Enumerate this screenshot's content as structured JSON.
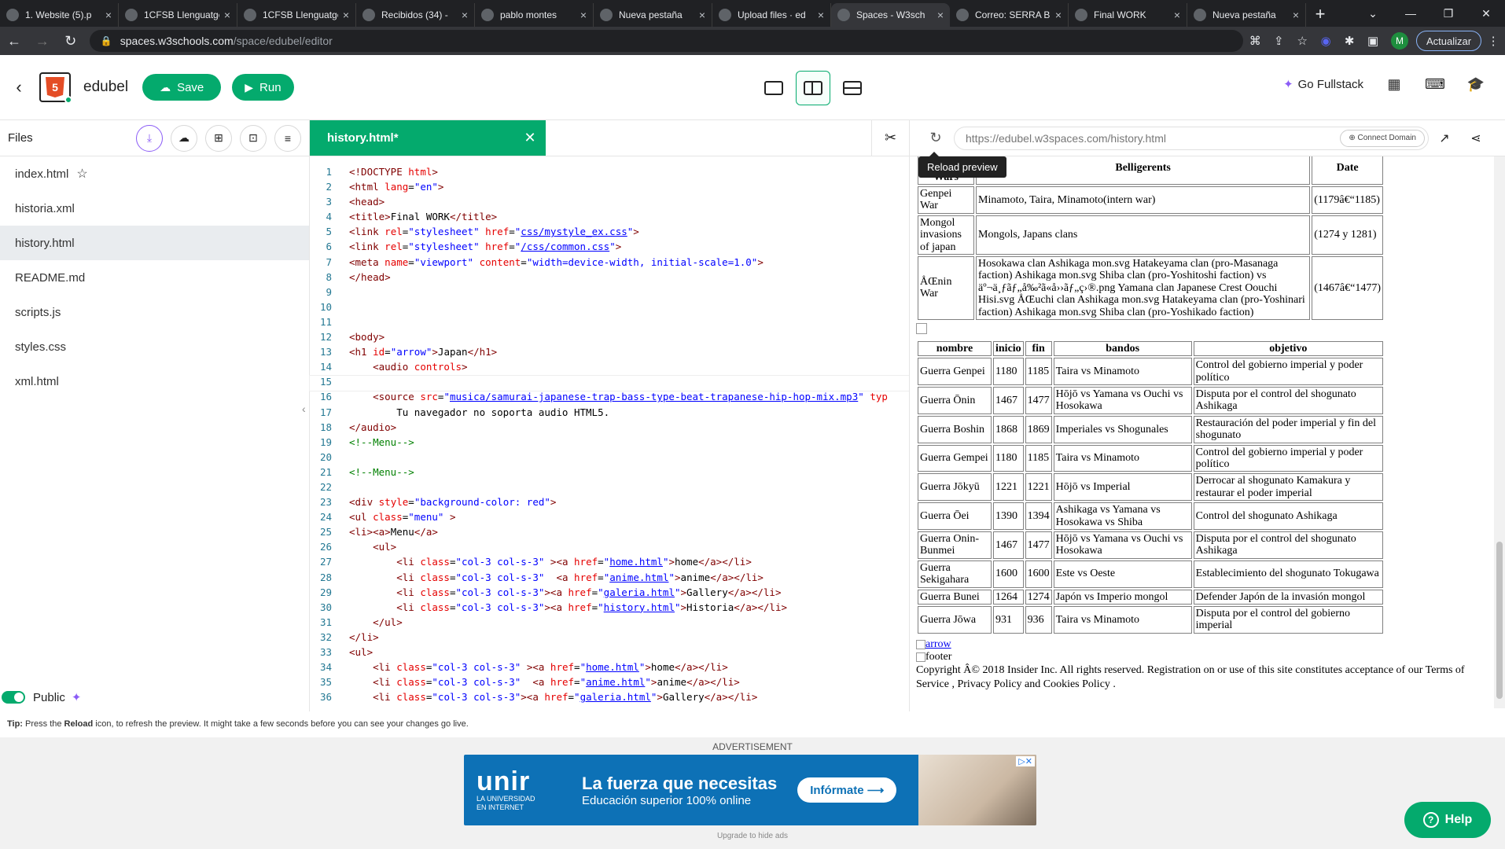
{
  "browser": {
    "tabs": [
      {
        "label": "1. Website (5).p",
        "icon": "chrome-icon"
      },
      {
        "label": "1CFSB Llenguatge",
        "icon": "doc-icon"
      },
      {
        "label": "1CFSB Llenguatge",
        "icon": "doc-icon"
      },
      {
        "label": "Recibidos (34) -",
        "icon": "gmail-icon"
      },
      {
        "label": "pablo montes",
        "icon": "sheets-icon"
      },
      {
        "label": "Nueva pestaña",
        "icon": "chrome-icon"
      },
      {
        "label": "Upload files · ed",
        "icon": "github-icon"
      },
      {
        "label": "Spaces - W3sch",
        "icon": "w3-icon",
        "active": true
      },
      {
        "label": "Correo: SERRA B",
        "icon": "outlook-icon"
      },
      {
        "label": "Final WORK",
        "icon": "chrome-icon"
      },
      {
        "label": "Nueva pestaña",
        "icon": "chrome-icon"
      }
    ],
    "url_host": "spaces.w3schools.com",
    "url_path": "/space/edubel/editor",
    "update_label": "Actualizar",
    "profile_initial": "M"
  },
  "header": {
    "space_name": "edubel",
    "save_label": "Save",
    "run_label": "Run",
    "go_fullstack_label": "Go Fullstack"
  },
  "files": {
    "title": "Files",
    "items": [
      "index.html",
      "historia.xml",
      "history.html",
      "README.md",
      "scripts.js",
      "styles.css",
      "xml.html"
    ],
    "selected": "history.html",
    "public_label": "Public"
  },
  "editor": {
    "tab_label": "history.html*",
    "lines": [
      {
        "n": "1",
        "h": "<span class='tg'>&lt;!DOCTYPE</span> <span class='at'>html</span><span class='tg'>&gt;</span>"
      },
      {
        "n": "2",
        "h": "<span class='tg'>&lt;html</span> <span class='at'>lang</span>=<span class='vl'>\"en\"</span><span class='tg'>&gt;</span>"
      },
      {
        "n": "3",
        "h": "<span class='tg'>&lt;head&gt;</span>"
      },
      {
        "n": "4",
        "h": "<span class='tg'>&lt;title&gt;</span>Final WORK<span class='tg'>&lt;/title&gt;</span>"
      },
      {
        "n": "5",
        "h": "<span class='tg'>&lt;link</span> <span class='at'>rel</span>=<span class='vl'>\"stylesheet\"</span> <span class='at'>href</span>=<span class='vl'>\"<span class='lk'>css/mystyle_ex.css</span>\"</span><span class='tg'>&gt;</span>"
      },
      {
        "n": "6",
        "h": "<span class='tg'>&lt;link</span> <span class='at'>rel</span>=<span class='vl'>\"stylesheet\"</span> <span class='at'>href</span>=<span class='vl'>\"<span class='lk'>/css/common.css</span>\"</span><span class='tg'>&gt;</span>"
      },
      {
        "n": "7",
        "h": "<span class='tg'>&lt;meta</span> <span class='at'>name</span>=<span class='vl'>\"viewport\"</span> <span class='at'>content</span>=<span class='vl'>\"width=device-width, initial-scale=1.0\"</span><span class='tg'>&gt;</span>"
      },
      {
        "n": "8",
        "h": "<span class='tg'>&lt;/head&gt;</span>"
      },
      {
        "n": "9",
        "h": ""
      },
      {
        "n": "10",
        "h": ""
      },
      {
        "n": "11",
        "h": ""
      },
      {
        "n": "12",
        "h": "<span class='tg'>&lt;body&gt;</span>"
      },
      {
        "n": "13",
        "h": "<span class='tg'>&lt;h1</span> <span class='at'>id</span>=<span class='vl'>\"arrow\"</span><span class='tg'>&gt;</span>Japan<span class='tg'>&lt;/h1&gt;</span>"
      },
      {
        "n": "14",
        "h": "    <span class='tg'>&lt;audio</span> <span class='at'>controls</span><span class='tg'>&gt;</span>"
      },
      {
        "n": "15",
        "h": "",
        "cur": true
      },
      {
        "n": "16",
        "h": "    <span class='tg'>&lt;source</span> <span class='at'>src</span>=<span class='vl'>\"<span class='lk'>musica/samurai-japanese-trap-bass-type-beat-trapanese-hip-hop-mix.mp3</span>\"</span> <span class='at'>typ</span>"
      },
      {
        "n": "17",
        "h": "        Tu navegador no soporta audio HTML5."
      },
      {
        "n": "18",
        "h": "<span class='tg'>&lt;/audio&gt;</span>"
      },
      {
        "n": "19",
        "h": "<span class='cm'>&lt;!--Menu--&gt;</span>"
      },
      {
        "n": "20",
        "h": ""
      },
      {
        "n": "21",
        "h": "<span class='cm'>&lt;!--Menu--&gt;</span>"
      },
      {
        "n": "22",
        "h": ""
      },
      {
        "n": "23",
        "h": "<span class='tg'>&lt;div</span> <span class='at'>style</span>=<span class='vl'>\"background-color: red\"</span><span class='tg'>&gt;</span>"
      },
      {
        "n": "24",
        "h": "<span class='tg'>&lt;ul</span> <span class='at'>class</span>=<span class='vl'>\"menu\"</span> <span class='tg'>&gt;</span>"
      },
      {
        "n": "25",
        "h": "<span class='tg'>&lt;li&gt;&lt;a&gt;</span>Menu<span class='tg'>&lt;/a&gt;</span>"
      },
      {
        "n": "26",
        "h": "    <span class='tg'>&lt;ul&gt;</span>"
      },
      {
        "n": "27",
        "h": "        <span class='tg'>&lt;li</span> <span class='at'>class</span>=<span class='vl'>\"col-3 col-s-3\"</span> <span class='tg'>&gt;&lt;a</span> <span class='at'>href</span>=<span class='vl'>\"<span class='lk'>home.html</span>\"</span><span class='tg'>&gt;</span>home<span class='tg'>&lt;/a&gt;&lt;/li&gt;</span>"
      },
      {
        "n": "28",
        "h": "        <span class='tg'>&lt;li</span> <span class='at'>class</span>=<span class='vl'>\"col-3 col-s-3\"</span>  <span class='tg'>&lt;a</span> <span class='at'>href</span>=<span class='vl'>\"<span class='lk'>anime.html</span>\"</span><span class='tg'>&gt;</span>anime<span class='tg'>&lt;/a&gt;&lt;/li&gt;</span>"
      },
      {
        "n": "29",
        "h": "        <span class='tg'>&lt;li</span> <span class='at'>class</span>=<span class='vl'>\"col-3 col-s-3\"</span><span class='tg'>&gt;&lt;a</span> <span class='at'>href</span>=<span class='vl'>\"<span class='lk'>galeria.html</span>\"</span><span class='tg'>&gt;</span>Gallery<span class='tg'>&lt;/a&gt;&lt;/li&gt;</span>"
      },
      {
        "n": "30",
        "h": "        <span class='tg'>&lt;li</span> <span class='at'>class</span>=<span class='vl'>\"col-3 col-s-3\"</span><span class='tg'>&gt;&lt;a</span> <span class='at'>href</span>=<span class='vl'>\"<span class='lk'>history.html</span>\"</span><span class='tg'>&gt;</span>Historia<span class='tg'>&lt;/a&gt;&lt;/li&gt;</span>"
      },
      {
        "n": "31",
        "h": "    <span class='tg'>&lt;/ul&gt;</span>"
      },
      {
        "n": "32",
        "h": "<span class='tg'>&lt;/li&gt;</span>"
      },
      {
        "n": "33",
        "h": "<span class='tg'>&lt;ul&gt;</span>"
      },
      {
        "n": "34",
        "h": "    <span class='tg'>&lt;li</span> <span class='at'>class</span>=<span class='vl'>\"col-3 col-s-3\"</span> <span class='tg'>&gt;&lt;a</span> <span class='at'>href</span>=<span class='vl'>\"<span class='lk'>home.html</span>\"</span><span class='tg'>&gt;</span>home<span class='tg'>&lt;/a&gt;&lt;/li&gt;</span>"
      },
      {
        "n": "35",
        "h": "    <span class='tg'>&lt;li</span> <span class='at'>class</span>=<span class='vl'>\"col-3 col-s-3\"</span>  <span class='tg'>&lt;a</span> <span class='at'>href</span>=<span class='vl'>\"<span class='lk'>anime.html</span>\"</span><span class='tg'>&gt;</span>anime<span class='tg'>&lt;/a&gt;&lt;/li&gt;</span>"
      },
      {
        "n": "36",
        "h": "    <span class='tg'>&lt;li</span> <span class='at'>class</span>=<span class='vl'>\"col-3 col-s-3\"</span><span class='tg'>&gt;&lt;a</span> <span class='at'>href</span>=<span class='vl'>\"<span class='lk'>galeria.html</span>\"</span><span class='tg'>&gt;</span>Gallery<span class='tg'>&lt;/a&gt;&lt;/li&gt;</span>"
      }
    ]
  },
  "preview": {
    "url": "https://edubel.w3spaces.com/history.html",
    "connect_domain_label": "Connect Domain",
    "tooltip": "Reload preview",
    "table1": {
      "headers": [
        "Wars",
        "Belligerents",
        "Date"
      ],
      "rows": [
        [
          "Genpei War",
          "Minamoto, Taira, Minamoto(intern war)",
          "(1179â€“1185)"
        ],
        [
          "Mongol invasions of japan",
          "Mongols, Japans clans",
          "(1274 y 1281)"
        ],
        [
          "ÅŒnin War",
          "Hosokawa clan Ashikaga mon.svg Hatakeyama clan (pro-Masanaga faction) Ashikaga mon.svg Shiba clan (pro-Yoshitoshi faction) vs äº¬ä¸ƒãƒ„å‰²ã«å››ãƒ„ç›®.png Yamana clan Japanese Crest Oouchi Hisi.svg ÅŒuchi clan Ashikaga mon.svg Hatakeyama clan (pro-Yoshinari faction) Ashikaga mon.svg Shiba clan (pro-Yoshikado faction)",
          "(1467â€“1477)"
        ]
      ]
    },
    "table2": {
      "headers": [
        "nombre",
        "inicio",
        "fin",
        "bandos",
        "objetivo"
      ],
      "rows": [
        [
          "Guerra Genpei",
          "1180",
          "1185",
          "Taira vs Minamoto",
          "Control del gobierno imperial y poder político"
        ],
        [
          "Guerra Ōnin",
          "1467",
          "1477",
          "Hōjō vs Yamana vs Ouchi vs Hosokawa",
          "Disputa por el control del shogunato Ashikaga"
        ],
        [
          "Guerra Boshin",
          "1868",
          "1869",
          "Imperiales vs Shogunales",
          "Restauración del poder imperial y fin del shogunato"
        ],
        [
          "Guerra Gempei",
          "1180",
          "1185",
          "Taira vs Minamoto",
          "Control del gobierno imperial y poder político"
        ],
        [
          "Guerra Jōkyū",
          "1221",
          "1221",
          "Hōjō vs Imperial",
          "Derrocar al shogunato Kamakura y restaurar el poder imperial"
        ],
        [
          "Guerra Ōei",
          "1390",
          "1394",
          "Ashikaga vs Yamana vs Hosokawa vs Shiba",
          "Control del shogunato Ashikaga"
        ],
        [
          "Guerra Onin-Bunmei",
          "1467",
          "1477",
          "Hōjō vs Yamana vs Ouchi vs Hosokawa",
          "Disputa por el control del shogunato Ashikaga"
        ],
        [
          "Guerra Sekigahara",
          "1600",
          "1600",
          "Este vs Oeste",
          "Establecimiento del shogunato Tokugawa"
        ],
        [
          "Guerra Bunei",
          "1264",
          "1274",
          "Japón vs Imperio mongol",
          "Defender Japón de la invasión mongol"
        ],
        [
          "Guerra Jōwa",
          "931",
          "936",
          "Taira vs Minamoto",
          "Disputa por el control del gobierno imperial"
        ]
      ]
    },
    "arrow_link": "arrow",
    "footer_alt": "footer",
    "copyright": "Copyright Â© 2018 Insider Inc. All rights reserved. Registration on or use of this site constitutes acceptance of our Terms of Service , Privacy Policy and Cookies Policy ."
  },
  "tip": {
    "prefix": "Tip:",
    "before": " Press the ",
    "bold": "Reload",
    "after": " icon, to refresh the preview. It might take a few seconds before you can see your changes go live."
  },
  "ad": {
    "label": "ADVERTISEMENT",
    "logo": "unir",
    "logo_sub1": "LA UNIVERSIDAD",
    "logo_sub2": "EN INTERNET",
    "headline": "La fuerza que necesitas",
    "subline": "Educación superior 100% online",
    "cta": "Infórmate ⟶",
    "upgrade": "Upgrade to hide ads"
  },
  "help_label": "Help",
  "colors": {
    "accent": "#04aa6d",
    "ai_purple": "#8b5cf6",
    "chrome_dark": "#202124"
  }
}
